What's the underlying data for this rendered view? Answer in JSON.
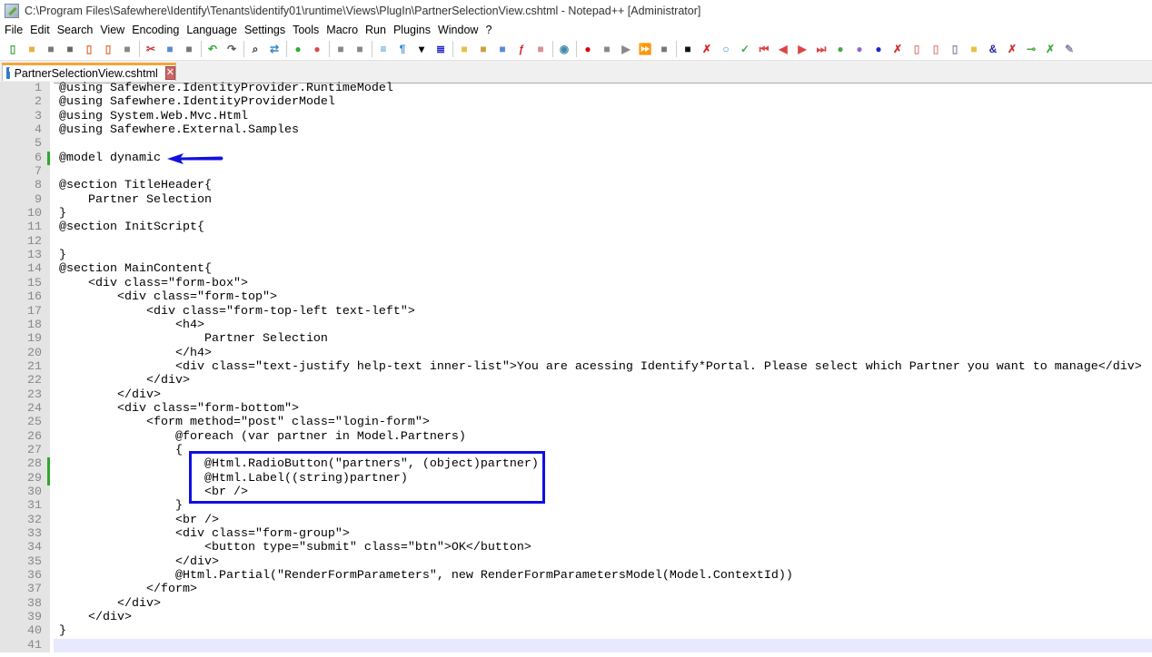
{
  "window": {
    "title": "C:\\Program Files\\Safewhere\\Identify\\Tenants\\identify01\\runtime\\Views\\PlugIn\\PartnerSelectionView.cshtml - Notepad++ [Administrator]"
  },
  "menu": [
    "File",
    "Edit",
    "Search",
    "View",
    "Encoding",
    "Language",
    "Settings",
    "Tools",
    "Macro",
    "Run",
    "Plugins",
    "Window",
    "?"
  ],
  "toolbar": [
    {
      "icon": "new-file-icon",
      "g": "▯",
      "c": "#4a4"
    },
    {
      "icon": "open-file-icon",
      "g": "■",
      "c": "#e8b040"
    },
    {
      "icon": "save-icon",
      "g": "■",
      "c": "#777"
    },
    {
      "icon": "save-all-icon",
      "g": "■",
      "c": "#666"
    },
    {
      "icon": "close-icon",
      "g": "▯",
      "c": "#e07030"
    },
    {
      "icon": "close-all-icon",
      "g": "▯",
      "c": "#e07030"
    },
    {
      "icon": "print-icon",
      "g": "■",
      "c": "#888"
    },
    {
      "sep": true
    },
    {
      "icon": "cut-icon",
      "g": "✂",
      "c": "#c33"
    },
    {
      "icon": "copy-icon",
      "g": "■",
      "c": "#5a8ad8"
    },
    {
      "icon": "paste-icon",
      "g": "■",
      "c": "#777"
    },
    {
      "sep": true
    },
    {
      "icon": "undo-icon",
      "g": "↶",
      "c": "#3a3"
    },
    {
      "icon": "redo-icon",
      "g": "↷",
      "c": "#555"
    },
    {
      "sep": true
    },
    {
      "icon": "find-icon",
      "g": "⌕",
      "c": "#333"
    },
    {
      "icon": "replace-icon",
      "g": "⇄",
      "c": "#38c"
    },
    {
      "sep": true
    },
    {
      "icon": "zoom-in-icon",
      "g": "●",
      "c": "#3a3"
    },
    {
      "icon": "zoom-out-icon",
      "g": "●",
      "c": "#d44"
    },
    {
      "sep": true
    },
    {
      "icon": "sync-vertical-icon",
      "g": "■",
      "c": "#888"
    },
    {
      "icon": "sync-horizontal-icon",
      "g": "■",
      "c": "#888"
    },
    {
      "sep": true
    },
    {
      "icon": "word-wrap-icon",
      "g": "≡",
      "c": "#38c"
    },
    {
      "icon": "show-all-chars-icon",
      "g": "¶",
      "c": "#38c"
    },
    {
      "icon": "dropdown-icon",
      "g": "▾",
      "c": "#000"
    },
    {
      "icon": "indent-guide-icon",
      "g": "≣",
      "c": "#22c"
    },
    {
      "sep": true
    },
    {
      "icon": "udl-icon",
      "g": "■",
      "c": "#e8c040"
    },
    {
      "icon": "doc-map-icon",
      "g": "■",
      "c": "#c9a040"
    },
    {
      "icon": "doc-list-icon",
      "g": "■",
      "c": "#5a8ad8"
    },
    {
      "icon": "function-list-icon",
      "g": "ƒ",
      "c": "#c33"
    },
    {
      "icon": "folder-as-workspace-icon",
      "g": "■",
      "c": "#e09090"
    },
    {
      "sep": true
    },
    {
      "icon": "monitoring-icon",
      "g": "◉",
      "c": "#48a"
    },
    {
      "sep": true
    },
    {
      "icon": "record-macro-icon",
      "g": "●",
      "c": "#d00"
    },
    {
      "icon": "stop-macro-icon",
      "g": "■",
      "c": "#888"
    },
    {
      "icon": "play-macro-icon",
      "g": "▶",
      "c": "#888"
    },
    {
      "icon": "run-macro-multiple-icon",
      "g": "⏩",
      "c": "#38c"
    },
    {
      "icon": "save-macro-icon",
      "g": "■",
      "c": "#777"
    },
    {
      "sep": true
    },
    {
      "icon": "console-icon",
      "g": "■",
      "c": "#111"
    },
    {
      "icon": "plugin-icon",
      "g": "✗",
      "c": "#d22"
    },
    {
      "icon": "plugin-icon",
      "g": "○",
      "c": "#38c"
    },
    {
      "icon": "plugin-icon",
      "g": "✓",
      "c": "#4a4"
    },
    {
      "icon": "first-icon",
      "g": "⏮",
      "c": "#d44"
    },
    {
      "icon": "prev-icon",
      "g": "◀",
      "c": "#d44"
    },
    {
      "icon": "next-icon",
      "g": "▶",
      "c": "#d44"
    },
    {
      "icon": "last-icon",
      "g": "⏭",
      "c": "#d44"
    },
    {
      "icon": "plugin-icon",
      "g": "●",
      "c": "#4a4"
    },
    {
      "icon": "plugin-icon",
      "g": "●",
      "c": "#96c"
    },
    {
      "icon": "plugin-icon",
      "g": "●",
      "c": "#22c"
    },
    {
      "icon": "plugin-icon",
      "g": "✗",
      "c": "#c33"
    },
    {
      "icon": "plugin-icon",
      "g": "▯",
      "c": "#d88"
    },
    {
      "icon": "plugin-icon",
      "g": "▯",
      "c": "#d88"
    },
    {
      "icon": "plugin-icon",
      "g": "▯",
      "c": "#88a"
    },
    {
      "icon": "plugin-icon",
      "g": "■",
      "c": "#e8c040"
    },
    {
      "icon": "plugin-icon",
      "g": "&",
      "c": "#22a"
    },
    {
      "icon": "plugin-icon",
      "g": "✗",
      "c": "#c33"
    },
    {
      "icon": "plugin-icon",
      "g": "⊸",
      "c": "#4a4"
    },
    {
      "icon": "plugin-icon",
      "g": "✗",
      "c": "#4a4"
    },
    {
      "icon": "plugin-icon",
      "g": "✎",
      "c": "#88a"
    }
  ],
  "tab": {
    "label": "PartnerSelectionView.cshtml"
  },
  "changed_lines": [
    6,
    28,
    29
  ],
  "current_line": 41,
  "annotation_color": "#1010e0",
  "lines": [
    "@using Safewhere.IdentityProvider.RuntimeModel",
    "@using Safewhere.IdentityProviderModel",
    "@using System.Web.Mvc.Html",
    "@using Safewhere.External.Samples",
    "",
    "@model dynamic",
    "",
    "@section TitleHeader{",
    "    Partner Selection",
    "}",
    "@section InitScript{",
    "",
    "}",
    "@section MainContent{",
    "    <div class=\"form-box\">",
    "        <div class=\"form-top\">",
    "            <div class=\"form-top-left text-left\">",
    "                <h4>",
    "                    Partner Selection",
    "                </h4>",
    "                <div class=\"text-justify help-text inner-list\">You are acessing Identify*Portal. Please select which Partner you want to manage</div>",
    "            </div>",
    "        </div>",
    "        <div class=\"form-bottom\">",
    "            <form method=\"post\" class=\"login-form\">",
    "                @foreach (var partner in Model.Partners)",
    "                {",
    "                    @Html.RadioButton(\"partners\", (object)partner)",
    "                    @Html.Label((string)partner)",
    "                    <br />",
    "                }",
    "                <br />",
    "                <div class=\"form-group\">",
    "                    <button type=\"submit\" class=\"btn\">OK</button>",
    "                </div>",
    "                @Html.Partial(\"RenderFormParameters\", new RenderFormParametersModel(Model.ContextId))",
    "            </form>",
    "        </div>",
    "    </div>",
    "}",
    ""
  ]
}
